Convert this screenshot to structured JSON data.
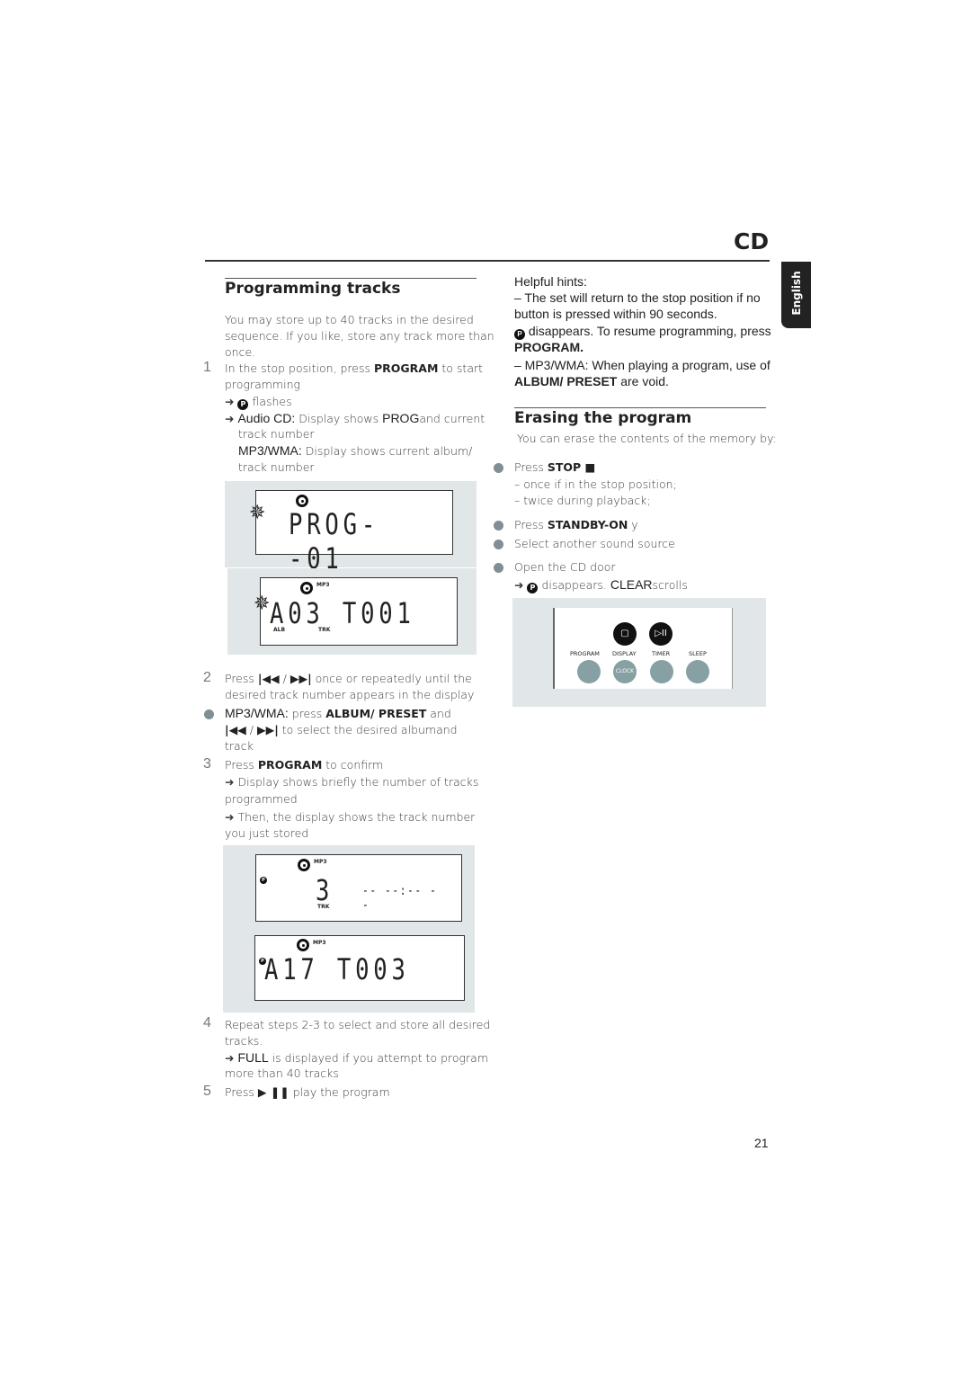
{
  "header": {
    "section": "CD",
    "language_tab": "English",
    "page_number": "21"
  },
  "programming": {
    "title": "Programming tracks",
    "intro": [
      "You may store up to 40 tracks in the desired",
      "sequence. If you like, store any track more than",
      "once."
    ],
    "step1": {
      "num": "1",
      "a": "In the stop position, press ",
      "b": "PROGRAM",
      "c": " to start",
      "line2": "programming",
      "p_icon": "P",
      "flashes": "flashes",
      "audio_a": "Audio CD:",
      "audio_b": " Display shows ",
      "audio_c": "PROG",
      "audio_d": "and current",
      "audio_line2": "track number",
      "mp3_a": "MP3/WMA:",
      "mp3_b": "  Display shows current album/",
      "mp3_line2": "track number"
    },
    "lcd1": {
      "text": "PROG--01"
    },
    "lcd2": {
      "text": "A03 T001",
      "mp3": "MP3",
      "alb": "ALB",
      "trk": "TRK"
    },
    "step2": {
      "num": "2",
      "a": "Press ",
      "prev": "|◀◀",
      "slash": " / ",
      "next": "▶▶|",
      "b": "  once or repeatedly until the",
      "line2": "desired track number appears in the display"
    },
    "mp3": {
      "a": "MP3/WMA:",
      "b": " press ",
      "c": "ALBUM/ PRESET",
      "d": "  and",
      "prev": "|◀◀",
      "slash": " / ",
      "next": "▶▶|",
      "e": "  to  select the desired albumand",
      "line3": "track"
    },
    "step3": {
      "num": "3",
      "a": "Press ",
      "b": "PROGRAM",
      "c": " to confirm",
      "r1": " Display shows briefly the number of tracks",
      "r1b": "programmed",
      "r2": " Then, the display shows the track number",
      "r2b": "you just stored"
    },
    "lcd3": {
      "text": "3",
      "time": "-- --:-- --",
      "mp3": "MP3",
      "trk": "TRK"
    },
    "lcd4": {
      "text": "A17 T003",
      "mp3": "MP3"
    },
    "step4": {
      "num": "4",
      "a": "Repeat steps 2-3 to select and store all desired",
      "line2": "tracks.",
      "full": "FULL",
      "full_b": " is displayed if you attempt to program",
      "line4": "more than 40 tracks"
    },
    "step5": {
      "num": "5",
      "a": "Press ",
      "play": "▶ ❚❚",
      "b": " play the program"
    }
  },
  "hints": {
    "title": "Helpful hints:",
    "l1": "–  The set will return to the stop position if no",
    "l2": "button is pressed within 90 seconds.",
    "p_icon": "P",
    "l3": " disappears. To resume programming, press",
    "l4": "PROGRAM.",
    "l5": "– MP3/WMA:  When playing a program, use of",
    "l6a": "ALBUM/ PRESET",
    "l6b": " are void."
  },
  "erasing": {
    "title": "Erasing the program",
    "intro": "You can erase the contents of the memory by:",
    "b1a": "Press ",
    "b1b": "STOP ■",
    "s1": "–  once if in the stop position;",
    "s2": "–  twice during playback;",
    "b2a": "Press ",
    "b2b": "STANDBY-ON",
    "b2c": " y",
    "b3": "Select another sound source",
    "b4": "Open the CD door",
    "r_p": "P",
    "r_a": " disappears. ",
    "r_b": "CLEAR",
    "r_c": "scrolls"
  },
  "panel": {
    "buttons": [
      {
        "label": "PROGRAM"
      },
      {
        "label": "DISPLAY",
        "sub": "CLOCK"
      },
      {
        "label": "TIMER"
      },
      {
        "label": "SLEEP"
      }
    ],
    "stop_glyph": "▢",
    "playpause_glyph": "▷II"
  },
  "colors": {
    "button": "#86a0a3",
    "panel_bg": "#e1e6e8"
  }
}
